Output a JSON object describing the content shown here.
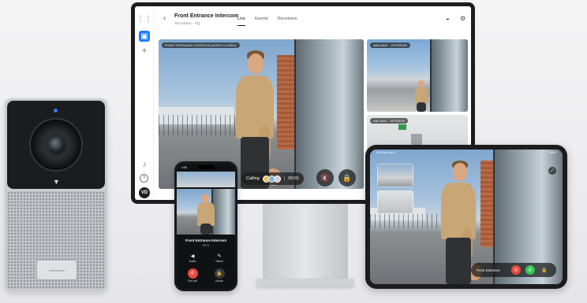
{
  "desktop": {
    "sidebar": {
      "grid_icon": "apps-grid-icon",
      "camera_icon": "camera-icon",
      "add_icon": "plus-icon",
      "bell_icon": "bell-icon",
      "help_icon": "help-icon",
      "avatar_initials": "VD"
    },
    "header": {
      "title": "Front Entrance Intercom",
      "subtitle": "San Mateo - HQ",
      "tabs": [
        {
          "label": "Live",
          "active": true
        },
        {
          "label": "Events",
          "active": false
        },
        {
          "label": "Receivers",
          "active": false
        }
      ]
    },
    "feeds": {
      "main_label": "FRONT ENTRANCE INTERCOM (DOOR CLOSED)",
      "side_1_label": "WALKWAY - EXTERIOR",
      "side_2_label": "HALLWAY - INTERIOR"
    },
    "call": {
      "status": "Calling",
      "timer": "00:01"
    }
  },
  "phone": {
    "time": "4:35",
    "title": "Front Entrance Intercom",
    "timer": "00:01",
    "controls": {
      "audio": "Audio",
      "muted": "Muted",
      "end_call": "End call",
      "unlock": "Unlock"
    }
  },
  "tablet": {
    "time": "9:41 Mon Jun 3",
    "battery": "100%",
    "bar_label": "Front Entrance"
  },
  "colors": {
    "accent": "#1e7bff",
    "end_call": "#e5493f",
    "accept": "#35c759"
  }
}
